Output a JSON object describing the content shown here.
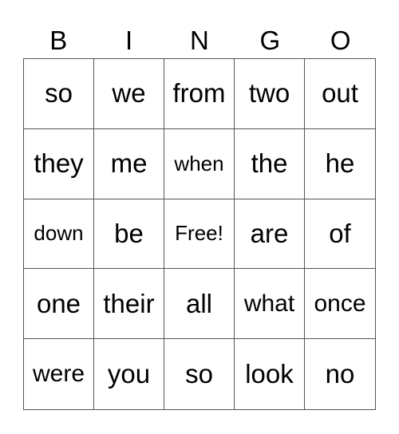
{
  "header": [
    "B",
    "I",
    "N",
    "G",
    "O"
  ],
  "cells": [
    [
      "so",
      "we",
      "from",
      "two",
      "out"
    ],
    [
      "they",
      "me",
      "when",
      "the",
      "he"
    ],
    [
      "down",
      "be",
      "Free!",
      "are",
      "of"
    ],
    [
      "one",
      "their",
      "all",
      "what",
      "once"
    ],
    [
      "were",
      "you",
      "so",
      "look",
      "no"
    ]
  ]
}
